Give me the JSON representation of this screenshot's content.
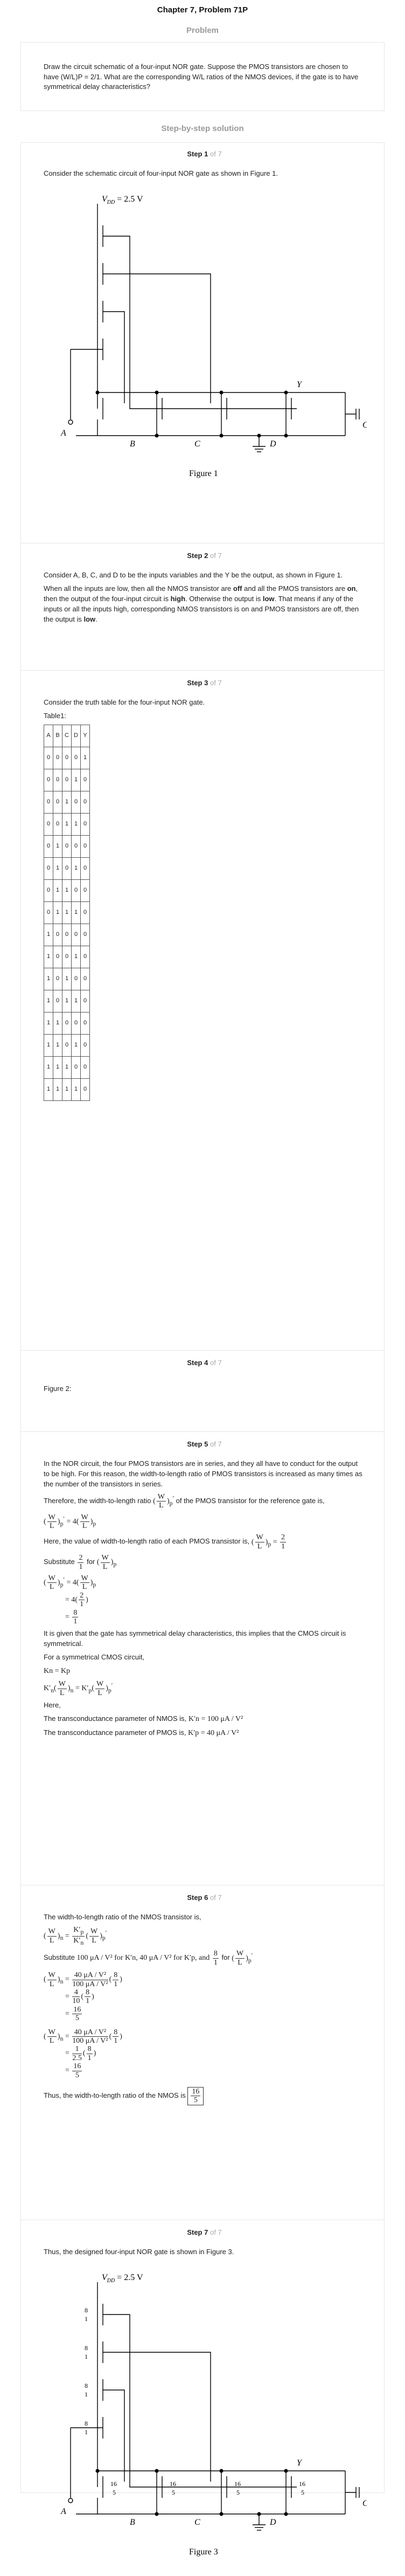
{
  "header": {
    "title": "Chapter 7, Problem 71P"
  },
  "problem": {
    "label": "Problem",
    "text": "Draw the circuit schematic of a four-input NOR gate. Suppose the PMOS transistors are chosen to have (W/L)P = 2/1. What are the corresponding W/L ratios of the NMOS devices, if the gate is to have symmetrical delay characteristics?"
  },
  "solution": {
    "label": "Step-by-step solution"
  },
  "step_word": "Step",
  "of_word": "of 7",
  "step1": {
    "num": "1",
    "text": "Consider the schematic circuit of four-input NOR gate as shown in Figure 1.",
    "vdd": "V",
    "vdd_sub": "DD",
    "vdd_val": "= 2.5 V",
    "labels": {
      "a": "A",
      "b": "B",
      "c": "C",
      "d": "D",
      "y": "Y",
      "cap": "C"
    },
    "caption": "Figure 1"
  },
  "step2": {
    "num": "2",
    "p1": "Consider A, B, C, and D to be the inputs variables and the Y be the output, as shown in Figure 1.",
    "p2a": "When all the inputs are low, then all the NMOS transistor are ",
    "p2b": "off",
    "p2c": " and all the PMOS transistors are ",
    "p2d": "on",
    "p2e": ", then the output of the four-input circuit is ",
    "p2f": "high",
    "p2g": ". Otherwise the output is ",
    "p2h": "low",
    "p2i": ". That means if any of the inputs or all the inputs high, corresponding NMOS transistors is on and PMOS transistors are off, then the output is ",
    "p2j": "low",
    "p2k": "."
  },
  "step3": {
    "num": "3",
    "text": "Consider the truth table for the four-input NOR gate.",
    "table_label": "Table1:",
    "headers": [
      "A",
      "B",
      "C",
      "D",
      "Y"
    ],
    "rows": [
      [
        "0",
        "0",
        "0",
        "0",
        "1"
      ],
      [
        "0",
        "0",
        "0",
        "1",
        "0"
      ],
      [
        "0",
        "0",
        "1",
        "0",
        "0"
      ],
      [
        "0",
        "0",
        "1",
        "1",
        "0"
      ],
      [
        "0",
        "1",
        "0",
        "0",
        "0"
      ],
      [
        "0",
        "1",
        "0",
        "1",
        "0"
      ],
      [
        "0",
        "1",
        "1",
        "0",
        "0"
      ],
      [
        "0",
        "1",
        "1",
        "1",
        "0"
      ],
      [
        "1",
        "0",
        "0",
        "0",
        "0"
      ],
      [
        "1",
        "0",
        "0",
        "1",
        "0"
      ],
      [
        "1",
        "0",
        "1",
        "0",
        "0"
      ],
      [
        "1",
        "0",
        "1",
        "1",
        "0"
      ],
      [
        "1",
        "1",
        "0",
        "0",
        "0"
      ],
      [
        "1",
        "1",
        "0",
        "1",
        "0"
      ],
      [
        "1",
        "1",
        "1",
        "0",
        "0"
      ],
      [
        "1",
        "1",
        "1",
        "1",
        "0"
      ]
    ]
  },
  "step4": {
    "num": "4",
    "text": "Figure 2:"
  },
  "step5": {
    "num": "5",
    "p1": "In the NOR circuit, the four PMOS transistors are in series, and they all have to conduct for the output to be high. For this reason, the width-to-length ratio of PMOS transistors is increased as many times as the number of the transistors in series.",
    "p2a": "Therefore, the width-to-length ratio",
    "p2b": "of the PMOS transistor for the reference gate is,",
    "eq_eq4": "= 4",
    "p3a": "Here, the value of width-to-length ratio of each PMOS transistor is,",
    "p3val_num": "2",
    "p3val_den": "1",
    "sub": "Substitute",
    "for": "for",
    "eq_eq": "=",
    "eq_4": "4",
    "eq_8": "8",
    "eq_1": "1",
    "p4": "It is given that the gate has symmetrical delay characteristics, this implies that the CMOS circuit is symmetrical.",
    "p5": "For a symmetrical CMOS circuit,",
    "kn_kp": "Kn = Kp",
    "here": "Here,",
    "tn": "The transconductance parameter of NMOS is,",
    "tn_val": "K′n = 100 μA / V²",
    "tp": "The transconductance parameter of PMOS is,",
    "tp_val": "K′p = 40 μA / V²"
  },
  "step6": {
    "num": "6",
    "p1": "The width-to-length ratio of the NMOS transistor is,",
    "sub1": "Substitute",
    "s_a": "100 μA / V² for K′n, 40 μA / V² for K′p, and",
    "s_b": "for",
    "v_40": "40 μA / V²",
    "v_100": "100 μA / V²",
    "v_8": "8",
    "v_1": "1",
    "v_4": "4",
    "v_10": "10",
    "v_16": "16",
    "v_5": "5",
    "v_2_5": "2.5",
    "conc": "Thus, the width-to-length ratio of the NMOS is"
  },
  "step7": {
    "num": "7",
    "text": "Thus, the designed four-input NOR gate is shown in Figure 3.",
    "caption": "Figure 3",
    "pm_num": "8",
    "pm_den": "1",
    "nm_num": "16",
    "nm_den": "5"
  }
}
